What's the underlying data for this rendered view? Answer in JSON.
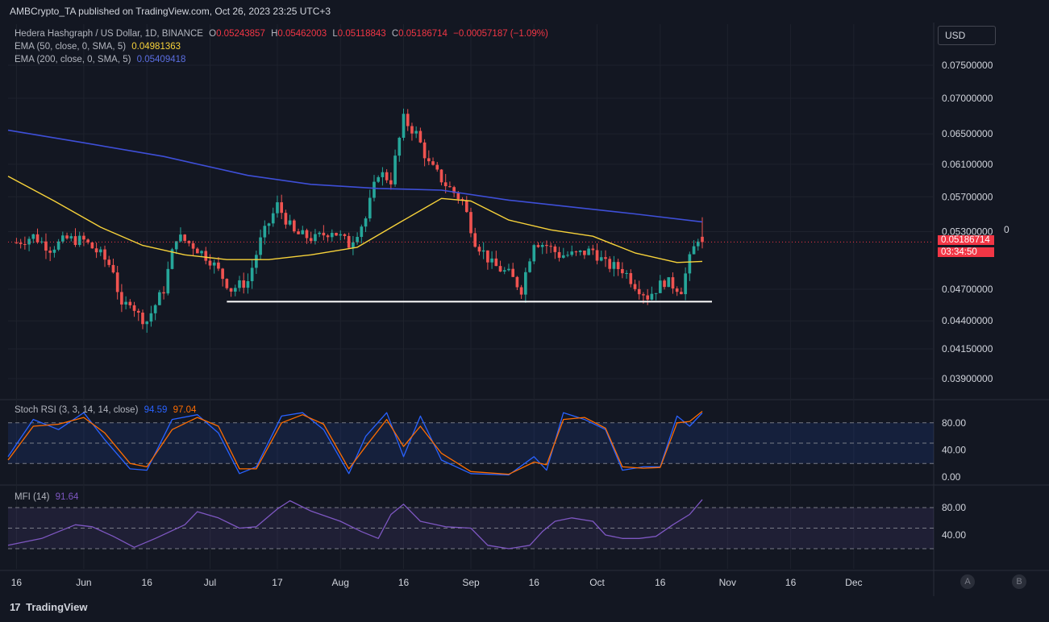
{
  "publish_line": "AMBCrypto_TA published on TradingView.com, Oct 26, 2023 23:25 UTC+3",
  "legend_main": {
    "symbol": "Hedera Hashgraph / US Dollar, 1D, BINANCE",
    "o_label": "O",
    "o": "0.05243857",
    "h_label": "H",
    "h": "0.05462003",
    "l_label": "L",
    "l": "0.05118843",
    "c_label": "C",
    "c": "0.05186714",
    "change": "−0.00057187 (−1.09%)"
  },
  "legend_ema50": {
    "label": "EMA (50, close, 0, SMA, 5)",
    "value": "0.04981363",
    "color": "#f7d23a"
  },
  "legend_ema200": {
    "label": "EMA (200, close, 0, SMA, 5)",
    "value": "0.05409418",
    "color": "#3e4fd8"
  },
  "legend_stoch": {
    "label": "Stoch RSI (3, 3, 14, 14, close)",
    "k": "94.59",
    "d": "97.04",
    "k_color": "#2962ff",
    "d_color": "#ff6d00"
  },
  "legend_mfi": {
    "label": "MFI (14)",
    "value": "91.64",
    "color": "#7e57c2"
  },
  "currency_button": "USD",
  "last_price": "0.05186714",
  "countdown": "03:34:50",
  "right_zero": "0",
  "price_axis_labels": [
    "0.07500000",
    "0.07000000",
    "0.06500000",
    "0.06100000",
    "0.05700000",
    "0.05300000",
    "0.04700000",
    "0.04400000",
    "0.04150000",
    "0.03900000"
  ],
  "stoch_axis_labels": [
    "80.00",
    "40.00",
    "0.00"
  ],
  "mfi_axis_labels": [
    "80.00",
    "40.00"
  ],
  "time_axis_labels": [
    "16",
    "Jun",
    "16",
    "Jul",
    "17",
    "Aug",
    "16",
    "Sep",
    "16",
    "Oct",
    "16",
    "Nov",
    "16",
    "Dec"
  ],
  "a_button": "A",
  "b_button": "B",
  "footer_brand": "TradingView",
  "footer_logo": "17",
  "chart_data": {
    "type": "candlestick",
    "timeframe": "1D",
    "price_scale": "log",
    "price_range": [
      0.038,
      0.0785
    ],
    "time_range": [
      "2023-05-14",
      "2023-12-20"
    ],
    "support_level": {
      "price": 0.0458,
      "from": "2023-07-05",
      "to": "2023-10-26",
      "color": "#ffffff"
    },
    "colors": {
      "up": "#26a69a",
      "down": "#ef5350",
      "ema50": "#f7d23a",
      "ema200": "#3e4fd8",
      "last_price_line": "#f23645"
    },
    "price_path_sampled_closes": [
      [
        "2023-05-16",
        0.0518
      ],
      [
        "2023-05-20",
        0.0525
      ],
      [
        "2023-05-24",
        0.0512
      ],
      [
        "2023-05-28",
        0.0522
      ],
      [
        "2023-06-01",
        0.052
      ],
      [
        "2023-06-05",
        0.0505
      ],
      [
        "2023-06-08",
        0.049
      ],
      [
        "2023-06-10",
        0.045
      ],
      [
        "2023-06-12",
        0.046
      ],
      [
        "2023-06-14",
        0.0445
      ],
      [
        "2023-06-16",
        0.044
      ],
      [
        "2023-06-20",
        0.047
      ],
      [
        "2023-06-23",
        0.0525
      ],
      [
        "2023-06-27",
        0.0515
      ],
      [
        "2023-07-01",
        0.05
      ],
      [
        "2023-07-06",
        0.047
      ],
      [
        "2023-07-10",
        0.0478
      ],
      [
        "2023-07-13",
        0.052
      ],
      [
        "2023-07-17",
        0.056
      ],
      [
        "2023-07-21",
        0.0528
      ],
      [
        "2023-07-26",
        0.0522
      ],
      [
        "2023-07-30",
        0.0532
      ],
      [
        "2023-08-03",
        0.0516
      ],
      [
        "2023-08-07",
        0.0545
      ],
      [
        "2023-08-10",
        0.06
      ],
      [
        "2023-08-13",
        0.059
      ],
      [
        "2023-08-16",
        0.067
      ],
      [
        "2023-08-19",
        0.065
      ],
      [
        "2023-08-22",
        0.061
      ],
      [
        "2023-08-26",
        0.0585
      ],
      [
        "2023-08-30",
        0.0565
      ],
      [
        "2023-09-02",
        0.052
      ],
      [
        "2023-09-06",
        0.0495
      ],
      [
        "2023-09-10",
        0.0485
      ],
      [
        "2023-09-13",
        0.047
      ],
      [
        "2023-09-16",
        0.052
      ],
      [
        "2023-09-19",
        0.0515
      ],
      [
        "2023-09-22",
        0.0505
      ],
      [
        "2023-09-26",
        0.0505
      ],
      [
        "2023-09-30",
        0.051
      ],
      [
        "2023-10-03",
        0.0495
      ],
      [
        "2023-10-07",
        0.049
      ],
      [
        "2023-10-10",
        0.0475
      ],
      [
        "2023-10-13",
        0.0463
      ],
      [
        "2023-10-17",
        0.0478
      ],
      [
        "2023-10-21",
        0.047
      ],
      [
        "2023-10-23",
        0.05
      ],
      [
        "2023-10-25",
        0.0524
      ],
      [
        "2023-10-26",
        0.05186714
      ]
    ],
    "ema50": [
      [
        "2023-05-14",
        0.0595
      ],
      [
        "2023-05-25",
        0.0565
      ],
      [
        "2023-06-05",
        0.0535
      ],
      [
        "2023-06-15",
        0.0515
      ],
      [
        "2023-06-25",
        0.0505
      ],
      [
        "2023-07-05",
        0.05
      ],
      [
        "2023-07-15",
        0.05
      ],
      [
        "2023-07-25",
        0.0505
      ],
      [
        "2023-08-05",
        0.0513
      ],
      [
        "2023-08-15",
        0.054
      ],
      [
        "2023-08-25",
        0.0568
      ],
      [
        "2023-09-01",
        0.0565
      ],
      [
        "2023-09-10",
        0.0543
      ],
      [
        "2023-09-20",
        0.0532
      ],
      [
        "2023-09-30",
        0.0525
      ],
      [
        "2023-10-10",
        0.0507
      ],
      [
        "2023-10-20",
        0.0497
      ],
      [
        "2023-10-26",
        0.04981363
      ]
    ],
    "ema200": [
      [
        "2023-05-14",
        0.0655
      ],
      [
        "2023-06-01",
        0.0638
      ],
      [
        "2023-06-20",
        0.062
      ],
      [
        "2023-07-10",
        0.0596
      ],
      [
        "2023-07-25",
        0.0585
      ],
      [
        "2023-08-10",
        0.058
      ],
      [
        "2023-08-25",
        0.0578
      ],
      [
        "2023-09-10",
        0.0566
      ],
      [
        "2023-09-25",
        0.0558
      ],
      [
        "2023-10-10",
        0.055
      ],
      [
        "2023-10-26",
        0.05409418
      ]
    ],
    "stoch_rsi": {
      "range": [
        0,
        100
      ],
      "bands": [
        20,
        80
      ],
      "k": [
        [
          "2023-05-14",
          30
        ],
        [
          "2023-05-20",
          85
        ],
        [
          "2023-05-26",
          70
        ],
        [
          "2023-06-01",
          95
        ],
        [
          "2023-06-06",
          55
        ],
        [
          "2023-06-12",
          12
        ],
        [
          "2023-06-16",
          10
        ],
        [
          "2023-06-22",
          85
        ],
        [
          "2023-06-28",
          92
        ],
        [
          "2023-07-03",
          65
        ],
        [
          "2023-07-08",
          5
        ],
        [
          "2023-07-12",
          15
        ],
        [
          "2023-07-18",
          90
        ],
        [
          "2023-07-23",
          95
        ],
        [
          "2023-07-28",
          70
        ],
        [
          "2023-08-03",
          5
        ],
        [
          "2023-08-07",
          60
        ],
        [
          "2023-08-12",
          95
        ],
        [
          "2023-08-16",
          30
        ],
        [
          "2023-08-20",
          90
        ],
        [
          "2023-08-25",
          25
        ],
        [
          "2023-09-01",
          5
        ],
        [
          "2023-09-10",
          3
        ],
        [
          "2023-09-16",
          30
        ],
        [
          "2023-09-19",
          10
        ],
        [
          "2023-09-23",
          95
        ],
        [
          "2023-09-28",
          85
        ],
        [
          "2023-10-03",
          70
        ],
        [
          "2023-10-07",
          10
        ],
        [
          "2023-10-12",
          15
        ],
        [
          "2023-10-16",
          15
        ],
        [
          "2023-10-20",
          90
        ],
        [
          "2023-10-23",
          75
        ],
        [
          "2023-10-26",
          94.59
        ]
      ],
      "d": [
        [
          "2023-05-14",
          25
        ],
        [
          "2023-05-20",
          75
        ],
        [
          "2023-05-26",
          78
        ],
        [
          "2023-06-01",
          88
        ],
        [
          "2023-06-06",
          65
        ],
        [
          "2023-06-12",
          20
        ],
        [
          "2023-06-16",
          15
        ],
        [
          "2023-06-22",
          70
        ],
        [
          "2023-06-28",
          88
        ],
        [
          "2023-07-03",
          75
        ],
        [
          "2023-07-08",
          12
        ],
        [
          "2023-07-12",
          12
        ],
        [
          "2023-07-18",
          80
        ],
        [
          "2023-07-23",
          92
        ],
        [
          "2023-07-28",
          78
        ],
        [
          "2023-08-03",
          12
        ],
        [
          "2023-08-07",
          45
        ],
        [
          "2023-08-12",
          85
        ],
        [
          "2023-08-16",
          45
        ],
        [
          "2023-08-20",
          75
        ],
        [
          "2023-08-25",
          35
        ],
        [
          "2023-09-01",
          8
        ],
        [
          "2023-09-10",
          4
        ],
        [
          "2023-09-16",
          22
        ],
        [
          "2023-09-19",
          18
        ],
        [
          "2023-09-23",
          85
        ],
        [
          "2023-09-28",
          88
        ],
        [
          "2023-10-03",
          72
        ],
        [
          "2023-10-07",
          15
        ],
        [
          "2023-10-12",
          13
        ],
        [
          "2023-10-16",
          14
        ],
        [
          "2023-10-20",
          80
        ],
        [
          "2023-10-23",
          82
        ],
        [
          "2023-10-26",
          97.04
        ]
      ]
    },
    "mfi": {
      "range": [
        0,
        100
      ],
      "bands": [
        20,
        50,
        80
      ],
      "values": [
        [
          "2023-05-14",
          25
        ],
        [
          "2023-05-22",
          35
        ],
        [
          "2023-05-30",
          55
        ],
        [
          "2023-06-03",
          52
        ],
        [
          "2023-06-08",
          38
        ],
        [
          "2023-06-13",
          22
        ],
        [
          "2023-06-18",
          35
        ],
        [
          "2023-06-25",
          55
        ],
        [
          "2023-06-28",
          74
        ],
        [
          "2023-07-03",
          65
        ],
        [
          "2023-07-08",
          50
        ],
        [
          "2023-07-12",
          52
        ],
        [
          "2023-07-17",
          78
        ],
        [
          "2023-07-20",
          90
        ],
        [
          "2023-07-25",
          75
        ],
        [
          "2023-08-01",
          60
        ],
        [
          "2023-08-06",
          45
        ],
        [
          "2023-08-10",
          35
        ],
        [
          "2023-08-13",
          70
        ],
        [
          "2023-08-16",
          85
        ],
        [
          "2023-08-20",
          60
        ],
        [
          "2023-08-26",
          52
        ],
        [
          "2023-09-01",
          50
        ],
        [
          "2023-09-05",
          25
        ],
        [
          "2023-09-10",
          20
        ],
        [
          "2023-09-15",
          25
        ],
        [
          "2023-09-18",
          45
        ],
        [
          "2023-09-21",
          60
        ],
        [
          "2023-09-25",
          65
        ],
        [
          "2023-09-30",
          60
        ],
        [
          "2023-10-03",
          40
        ],
        [
          "2023-10-07",
          35
        ],
        [
          "2023-10-11",
          35
        ],
        [
          "2023-10-15",
          38
        ],
        [
          "2023-10-19",
          55
        ],
        [
          "2023-10-23",
          70
        ],
        [
          "2023-10-26",
          91.64
        ]
      ]
    }
  }
}
